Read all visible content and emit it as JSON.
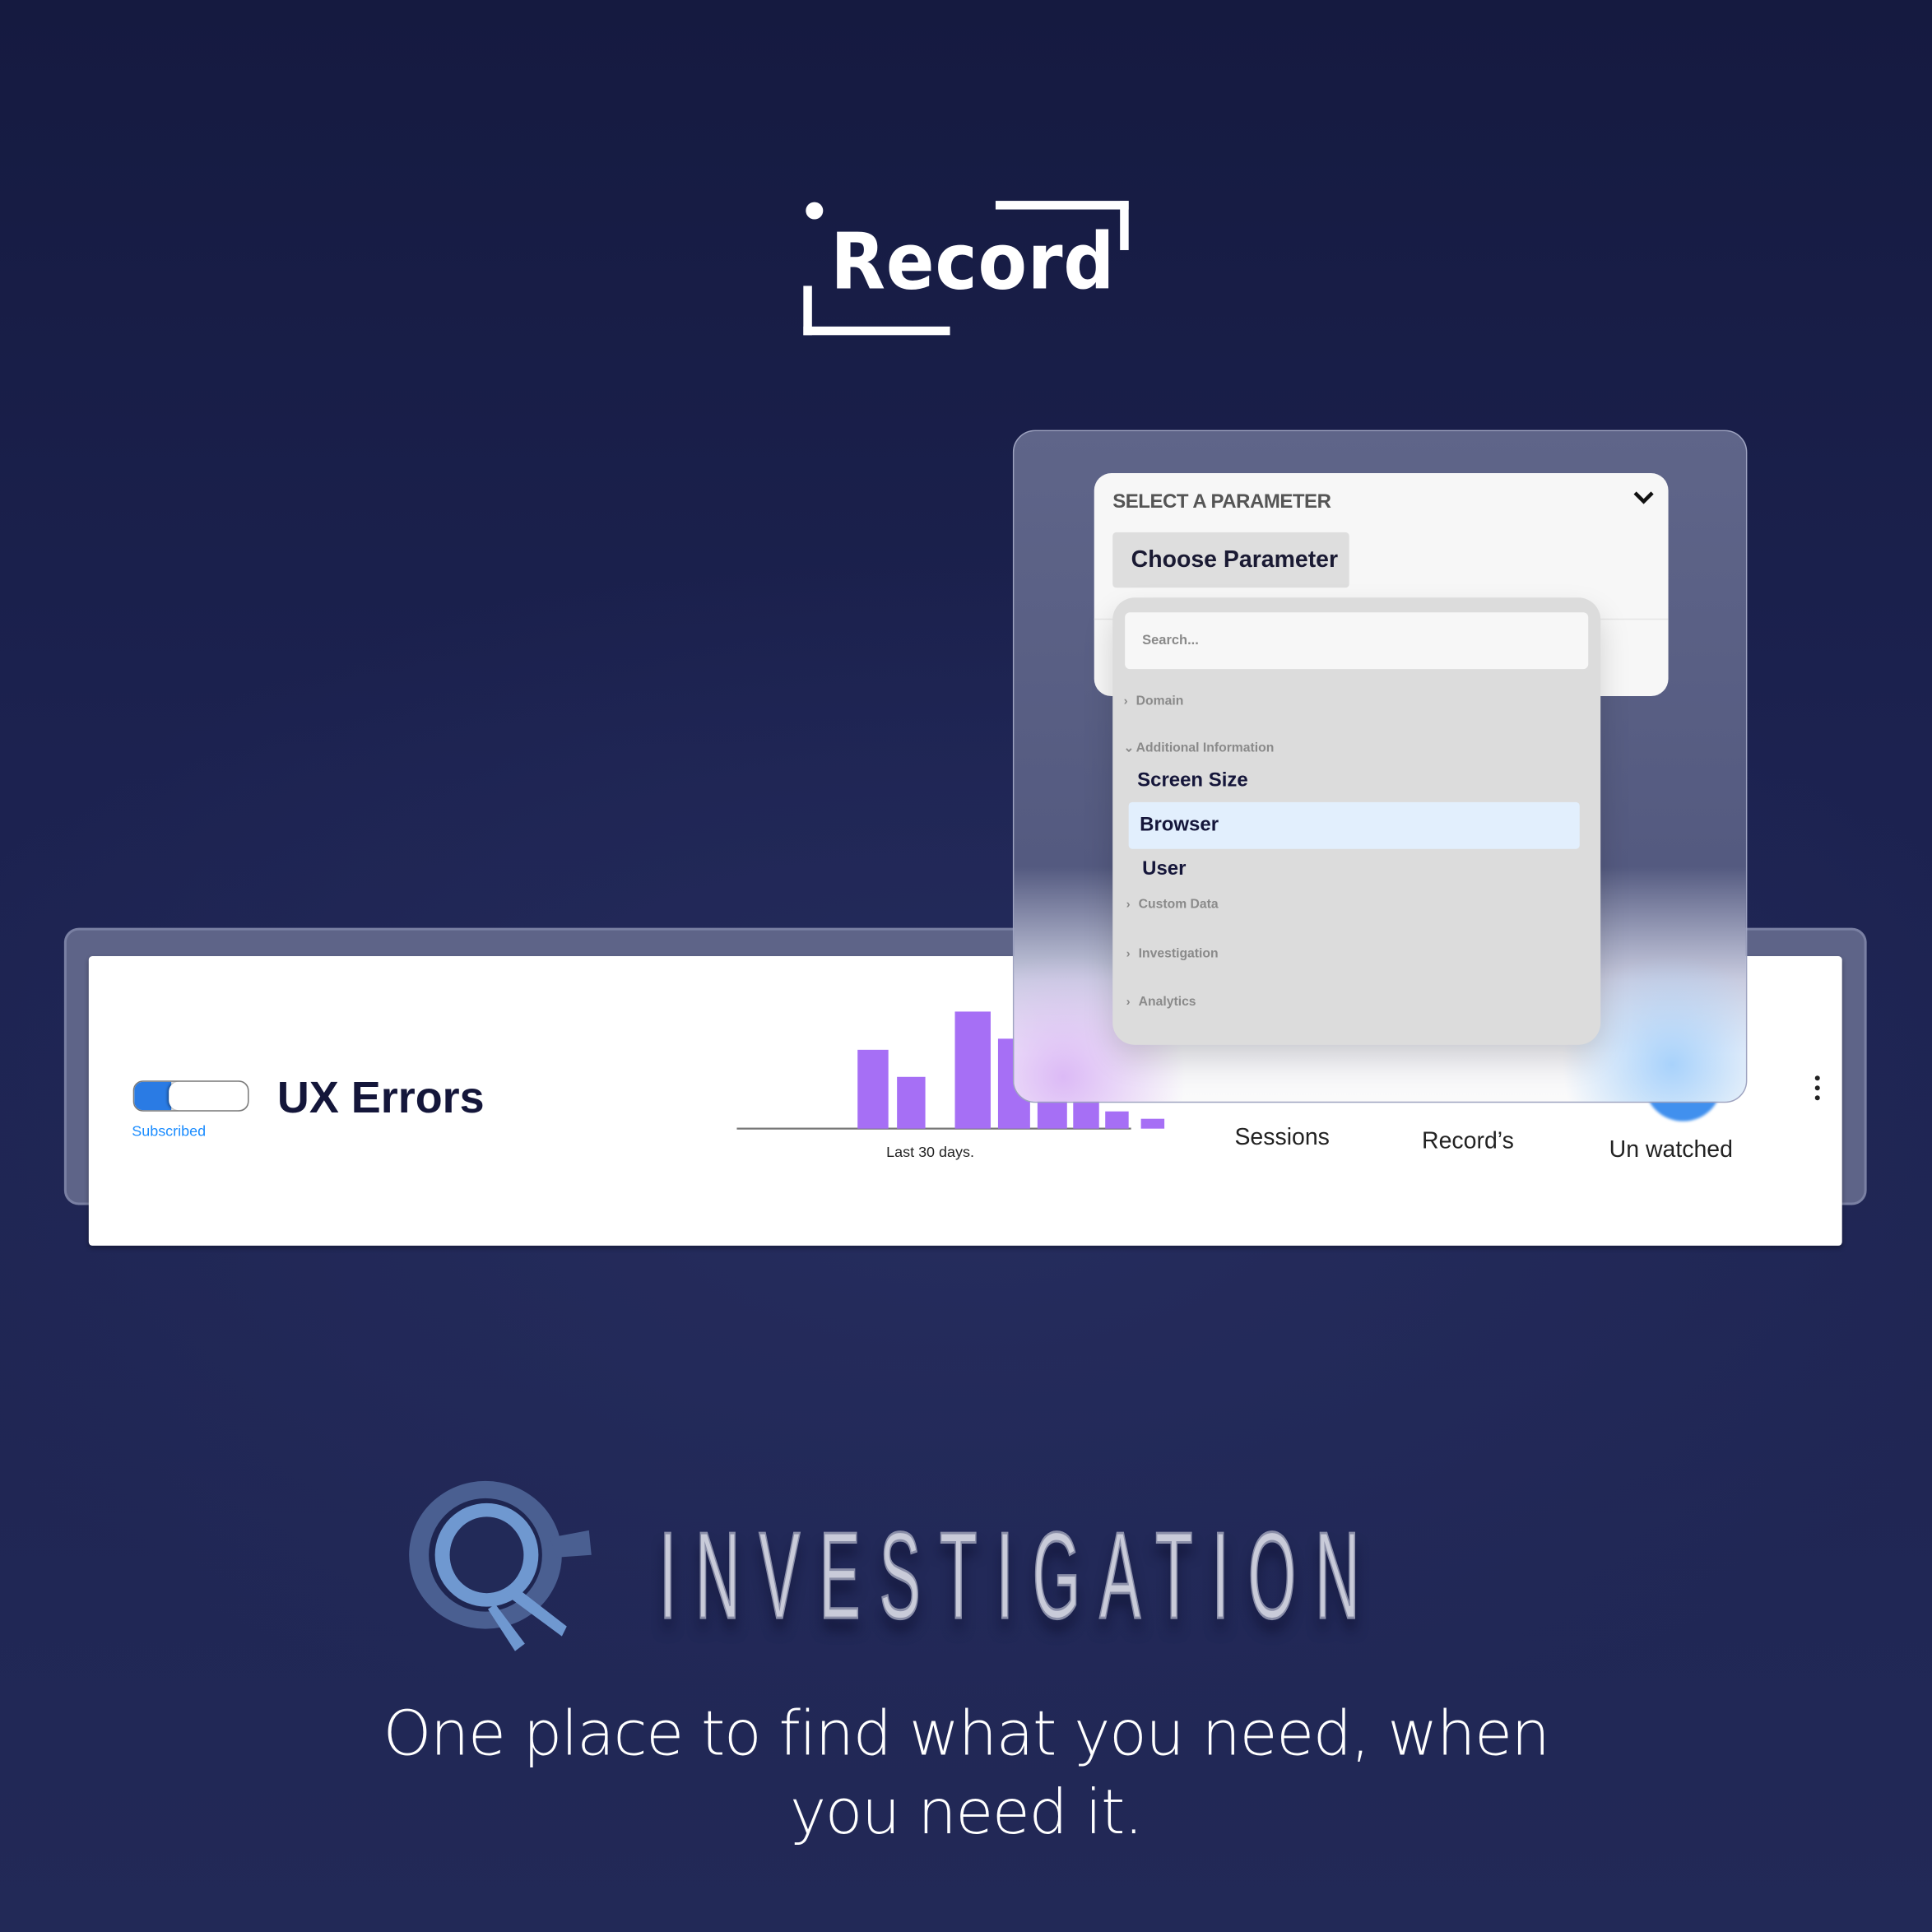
{
  "brand": {
    "logo_text": "Record"
  },
  "widget": {
    "toggle_state": "on",
    "subscribed_label": "Subscribed",
    "title": "UX Errors",
    "chart_caption": "Last 30 days.",
    "metrics": [
      "Sessions",
      "Record’s",
      "Un watched"
    ],
    "menu_icon": "kebab-icon"
  },
  "chart_data": {
    "type": "bar",
    "values": [
      64,
      42,
      95,
      73,
      55,
      40,
      14,
      8
    ],
    "bar_color": "#a66ff5",
    "xlabel": "Last 30 days.",
    "grid": false
  },
  "parameter_panel": {
    "label": "SELECT A PARAMETER",
    "button_label": "Choose Parameter",
    "search_placeholder": "Search...",
    "groups": [
      {
        "label": "Domain",
        "expanded": false
      },
      {
        "label": "Additional Information",
        "expanded": true,
        "options": [
          "Screen Size",
          "Browser",
          "User"
        ],
        "selected": "Browser"
      },
      {
        "label": "Custom Data",
        "expanded": false
      },
      {
        "label": "Investigation",
        "expanded": false
      },
      {
        "label": "Analytics",
        "expanded": false
      }
    ]
  },
  "product": {
    "name": "INVESTIGATION",
    "icon": "magnifier-target-icon"
  },
  "tagline": {
    "line1": "One place to find what you need, when",
    "line2": "you need it."
  },
  "colors": {
    "background": "#181d45",
    "accent_purple": "#a66ff5",
    "toggle_blue": "#2a7be4",
    "selected_row": "#e2effd"
  }
}
